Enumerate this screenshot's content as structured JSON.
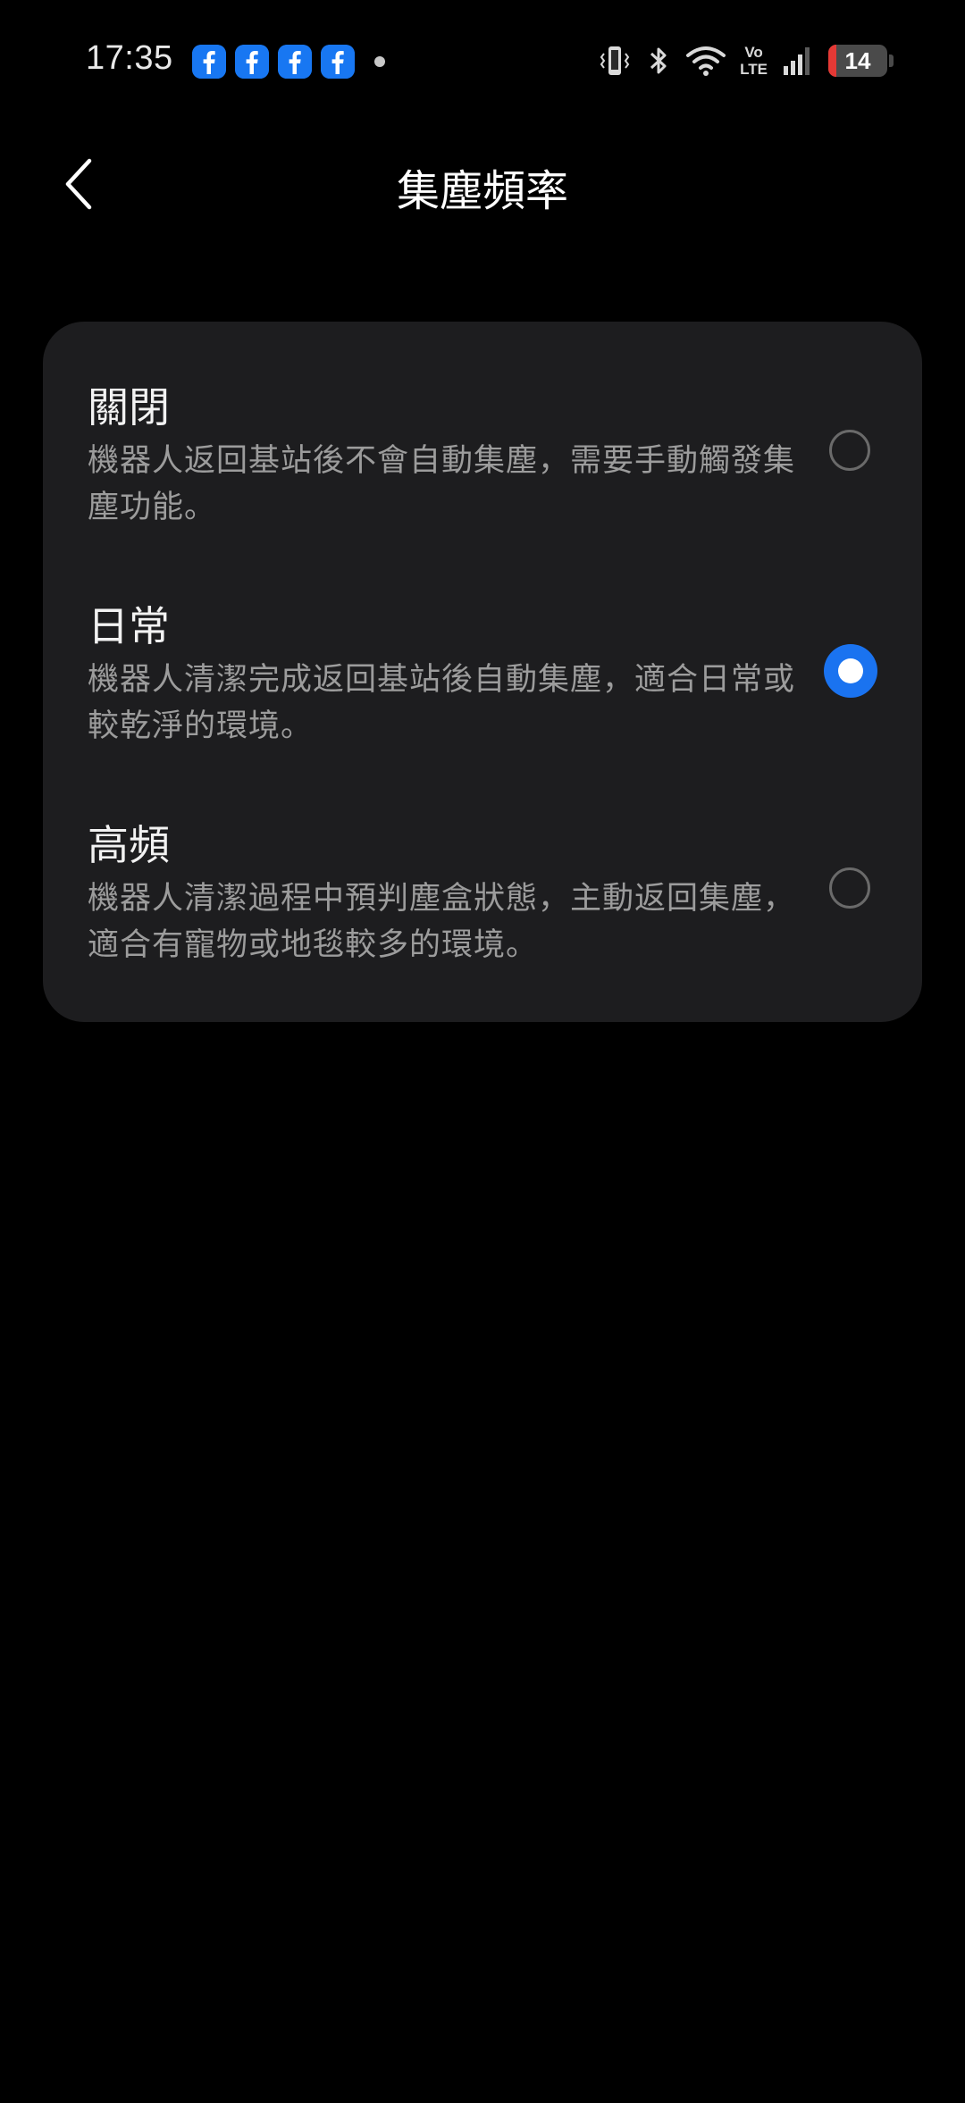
{
  "status_bar": {
    "time": "17:35",
    "notification_icons": [
      "facebook-icon",
      "facebook-icon",
      "facebook-icon",
      "facebook-icon"
    ],
    "volte_top": "Vo",
    "volte_bottom": "LTE",
    "battery_level": "14",
    "battery_fraction": 0.14
  },
  "header": {
    "title": "集塵頻率"
  },
  "options": [
    {
      "title": "關閉",
      "description": "機器人返回基站後不會自動集塵，需要手動觸發集塵功能。",
      "selected": false
    },
    {
      "title": "日常",
      "description": "機器人清潔完成返回基站後自動集塵，適合日常或較乾淨的環境。",
      "selected": true
    },
    {
      "title": "高頻",
      "description": "機器人清潔過程中預判塵盒狀態，主動返回集塵，適合有寵物或地毯較多的環境。",
      "selected": false
    }
  ],
  "colors": {
    "background": "#000000",
    "card": "#1d1d1f",
    "accent": "#1a73f0",
    "battery_low": "#e53935"
  }
}
